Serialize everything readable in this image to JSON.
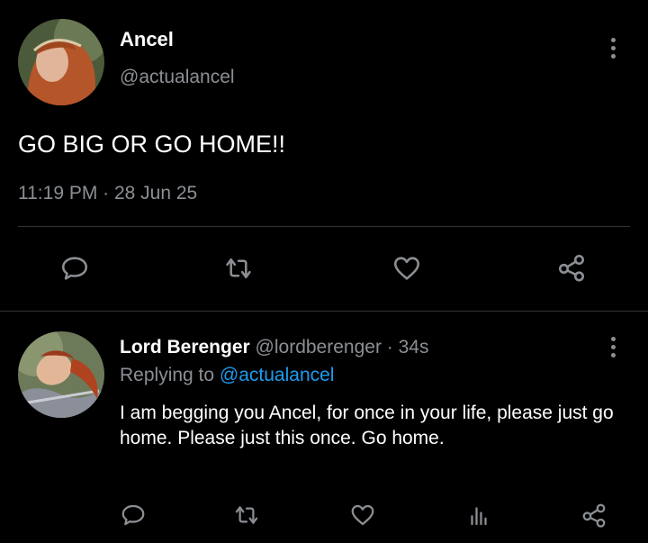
{
  "main_tweet": {
    "display_name": "Ancel",
    "handle": "@actualancel",
    "text": "GO BIG OR GO HOME!!",
    "timestamp": "11:19 PM · 28 Jun 25",
    "actions": [
      "reply-icon",
      "retweet-icon",
      "like-icon",
      "share-icon"
    ]
  },
  "reply": {
    "display_name": "Lord Berenger",
    "handle": "@lordberenger",
    "time": "· 34s",
    "replying_prefix": "Replying to",
    "replying_handle": "@actualancel",
    "text": "I am begging you Ancel, for once in your life, please just go home. Please just this once. Go home.",
    "actions": [
      "reply-icon",
      "retweet-icon",
      "like-icon",
      "analytics-icon",
      "share-icon"
    ]
  },
  "colors": {
    "background": "#000000",
    "text": "#e7e9ea",
    "muted": "#8b8f94",
    "link": "#1d9bf0",
    "divider": "#2f3336"
  }
}
